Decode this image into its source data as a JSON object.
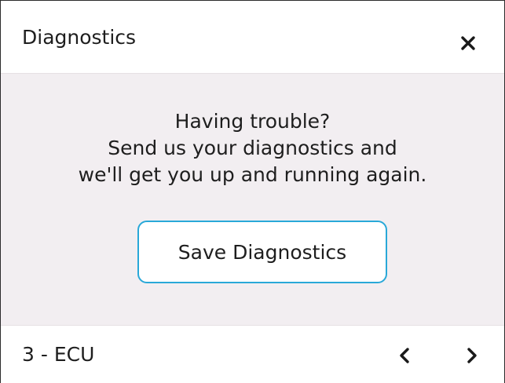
{
  "header": {
    "title": "Diagnostics",
    "close_icon": "close-icon"
  },
  "message": {
    "line1": "Having trouble?",
    "line2": "Send us your diagnostics and",
    "line3": "we'll get you up and running again."
  },
  "actions": {
    "save_label": "Save Diagnostics"
  },
  "footer": {
    "label": "3 - ECU",
    "prev_icon": "chevron-left-icon",
    "next_icon": "chevron-right-icon"
  },
  "colors": {
    "accent": "#29a8d8",
    "body_background": "#f2eef1",
    "text": "#1e1e1e"
  }
}
